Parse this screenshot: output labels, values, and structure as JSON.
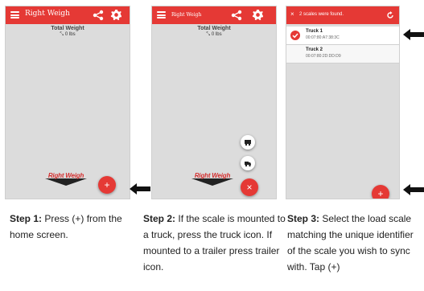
{
  "app": {
    "title": "Right Weigh",
    "total_weight_label": "Total Weight",
    "total_weight_value": "0 lbs",
    "brand_name": "Right Weigh",
    "accent_color": "#e53935"
  },
  "screen1": {
    "fab_label": "+"
  },
  "screen2": {
    "fab_label": "×",
    "mini_buttons": [
      {
        "icon": "trailer-icon"
      },
      {
        "icon": "truck-icon"
      }
    ]
  },
  "screen3": {
    "bar_title": "2 scales were found.",
    "close_label": "×",
    "scales": [
      {
        "name": "Truck 1",
        "id": "00:07:80:A7:38:3C",
        "selected": true
      },
      {
        "name": "Truck 2",
        "id": "00:07:80:2D:DD:D9",
        "selected": false
      }
    ],
    "fab_label": "+"
  },
  "captions": [
    {
      "step": "Step 1:",
      "text": "Press (+) from the home screen."
    },
    {
      "step": "Step 2:",
      "text": "If the scale is mounted to a truck, press the truck icon.  If mounted to a trailer press trailer icon."
    },
    {
      "step": "Step 3:",
      "text": "Select the load scale matching the unique identifier of the scale you wish to sync with.  Tap (+)"
    }
  ]
}
